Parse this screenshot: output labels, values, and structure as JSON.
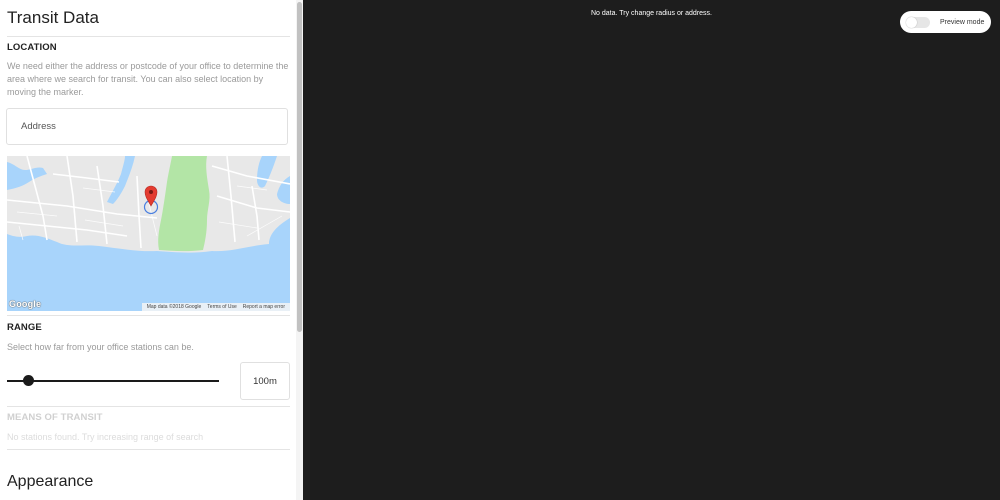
{
  "sidebar": {
    "title": "Transit Data",
    "location": {
      "heading": "LOCATION",
      "help": "We need either the address or postcode of your office to determine the area where we search for transit. You can also select location by moving the marker.",
      "address_placeholder": "Address",
      "address_value": ""
    },
    "map": {
      "logo": "Google",
      "attribution": [
        "Map data ©2018 Google",
        "Terms of Use",
        "Report a map error"
      ],
      "colors": {
        "water": "#a8d4fb",
        "land": "#e8e8e8",
        "park": "#b3e5a6",
        "marker": "#e33b30"
      }
    },
    "range": {
      "heading": "RANGE",
      "help": "Select how far from your office stations can be.",
      "value_label": "100m",
      "slider_fraction": 0.1
    },
    "transit": {
      "heading": "MEANS OF TRANSIT",
      "help": "No stations found. Try increasing range of search"
    },
    "appearance_title": "Appearance"
  },
  "main": {
    "no_data_message": "No data. Try change radius or address.",
    "preview_toggle": {
      "label": "Preview mode",
      "on": false
    },
    "background_color": "#1d1d1d"
  }
}
